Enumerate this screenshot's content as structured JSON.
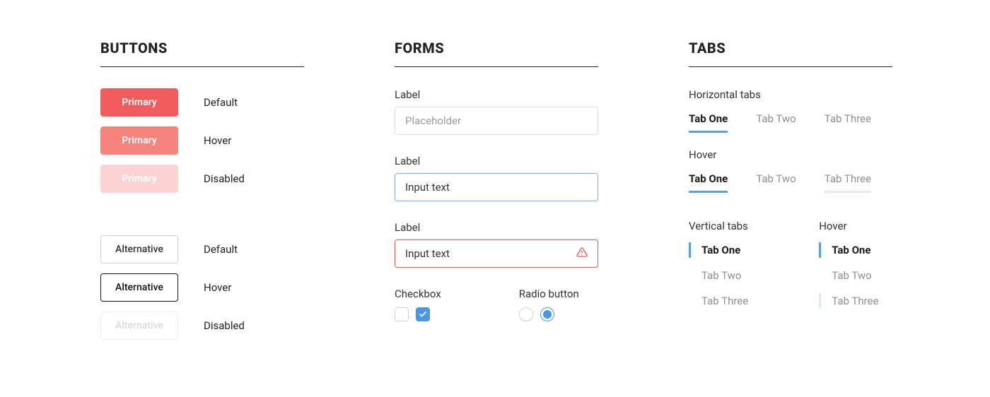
{
  "sections": {
    "buttons": "BUTTONS",
    "forms": "FORMS",
    "tabs": "TABS"
  },
  "buttons": {
    "primary": {
      "label": "Primary"
    },
    "alternative": {
      "label": "Alternative"
    },
    "states": {
      "default": "Default",
      "hover": "Hover",
      "disabled": "Disabled"
    }
  },
  "forms": {
    "label_text": "Label",
    "placeholder_input": {
      "placeholder": "Placeholder"
    },
    "active_input": {
      "value": "Input text"
    },
    "error_input": {
      "value": "Input text"
    },
    "checkbox_title": "Checkbox",
    "radio_title": "Radio button"
  },
  "tabs": {
    "horizontal_label": "Horizontal tabs",
    "hover_label": "Hover",
    "vertical_label": "Vertical tabs",
    "items": {
      "one": "Tab One",
      "two": "Tab Two",
      "three": "Tab Three"
    }
  },
  "colors": {
    "primary_red": "#f15b5b",
    "primary_red_hover": "#f7837d",
    "primary_red_disabled": "#fcd3d2",
    "accent_blue": "#4b97e3",
    "tab_blue": "#5b9ee6",
    "error_red": "#ef5552"
  }
}
